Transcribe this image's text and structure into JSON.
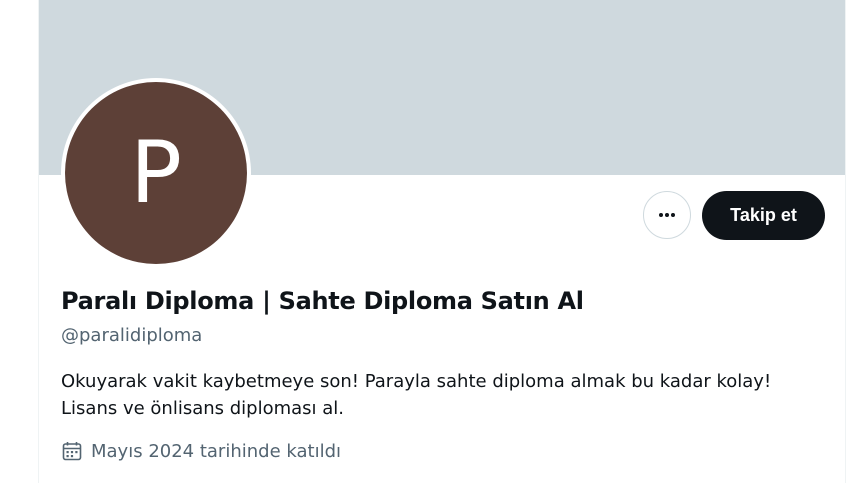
{
  "profile": {
    "avatar_letter": "P",
    "avatar_color": "#5d4037",
    "banner_color": "#cfd9de",
    "display_name": "Paralı Diploma | Sahte Diploma Satın Al",
    "handle": "@paralidiploma",
    "bio_lines": [
      "Okuyarak vakit kaybetmeye son! Parayla sahte diploma almak bu kadar kolay!",
      "Lisans ve önlisans diploması al."
    ],
    "joined_text": "Mayıs 2024 tarihinde katıldı",
    "joined_icon": "calendar-icon"
  },
  "actions": {
    "more_icon": "more-options-icon",
    "follow_label": "Takip et"
  }
}
